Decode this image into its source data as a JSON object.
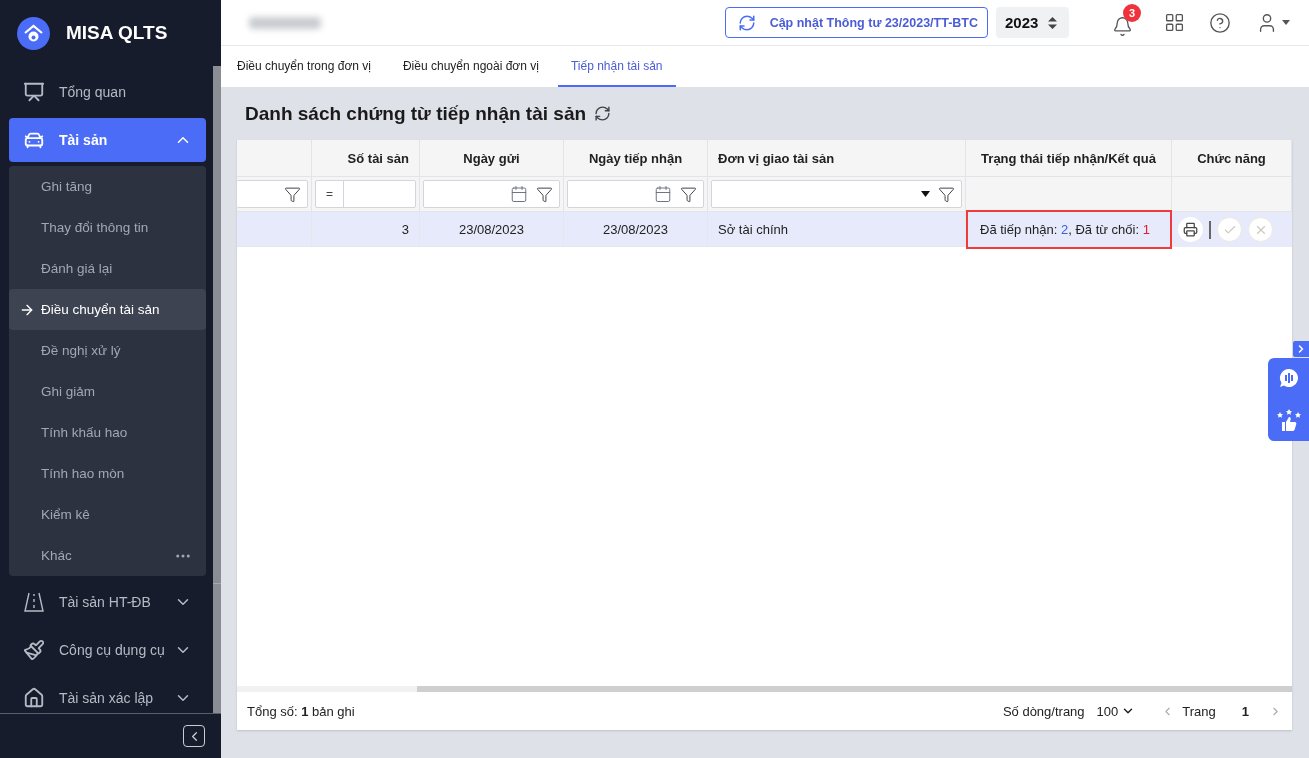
{
  "app": {
    "name": "MISA QLTS"
  },
  "sidebar": {
    "items": [
      {
        "label": "Tổng quan",
        "selected": false
      },
      {
        "label": "Tài sản",
        "selected": true,
        "expanded": true,
        "children": [
          {
            "label": "Ghi tăng",
            "selected": false
          },
          {
            "label": "Thay đổi thông tin",
            "selected": false
          },
          {
            "label": "Đánh giá lại",
            "selected": false
          },
          {
            "label": "Điều chuyển tài sản",
            "selected": true
          },
          {
            "label": "Đề nghị xử lý",
            "selected": false
          },
          {
            "label": "Ghi giảm",
            "selected": false
          },
          {
            "label": "Tính khấu hao",
            "selected": false
          },
          {
            "label": "Tính hao mòn",
            "selected": false
          },
          {
            "label": "Kiểm kê",
            "selected": false
          },
          {
            "label": "Khác",
            "selected": false,
            "more": true
          }
        ]
      },
      {
        "label": "Tài sản HT-ĐB",
        "selected": false,
        "expanded": false
      },
      {
        "label": "Công cụ dụng cụ",
        "selected": false,
        "expanded": false
      },
      {
        "label": "Tài sản xác lập",
        "selected": false,
        "expanded": false
      }
    ]
  },
  "header": {
    "update_button": "Cập nhật Thông tư 23/2023/TT-BTC",
    "year": "2023",
    "notification_count": "3"
  },
  "tabs": [
    {
      "label": "Điều chuyển trong đơn vị",
      "selected": false
    },
    {
      "label": "Điều chuyển ngoài đơn vị",
      "selected": false
    },
    {
      "label": "Tiếp nhận tài sản",
      "selected": true
    }
  ],
  "page_title": "Danh sách chứng từ tiếp nhận tài sản",
  "table": {
    "columns": [
      {
        "kind": "text"
      },
      {
        "label": "Số tài sản",
        "kind": "number",
        "operator": "="
      },
      {
        "label": "Ngày gửi",
        "kind": "date"
      },
      {
        "label": "Ngày tiếp nhận",
        "kind": "date"
      },
      {
        "label": "Đơn vị giao tài sản",
        "kind": "select"
      },
      {
        "label": "Trạng thái tiếp nhận/Kết quả",
        "kind": "status"
      },
      {
        "label": "Chức năng",
        "kind": "actions"
      }
    ],
    "rows": [
      {
        "selected": true,
        "cells": [
          "",
          "3",
          "23/08/2023",
          "23/08/2023",
          "Sở tài chính"
        ],
        "status": {
          "highlighted": true,
          "segments": [
            {
              "kind": "label",
              "text": "Đã tiếp nhận: "
            },
            {
              "kind": "accepted",
              "text": "2"
            },
            {
              "kind": "label",
              "text": ", Đã từ chối: "
            },
            {
              "kind": "rejected",
              "text": "1"
            }
          ]
        },
        "actions": [
          {
            "kind": "print",
            "disabled": false
          },
          {
            "kind": "approve",
            "disabled": true
          },
          {
            "kind": "reject",
            "disabled": true
          }
        ]
      }
    ]
  },
  "footer": {
    "total": "Tổng số: **1** bản ghi",
    "page_size_label": "Số dòng/trang",
    "page_size": "100",
    "page_label": "Trang",
    "page": "1"
  }
}
